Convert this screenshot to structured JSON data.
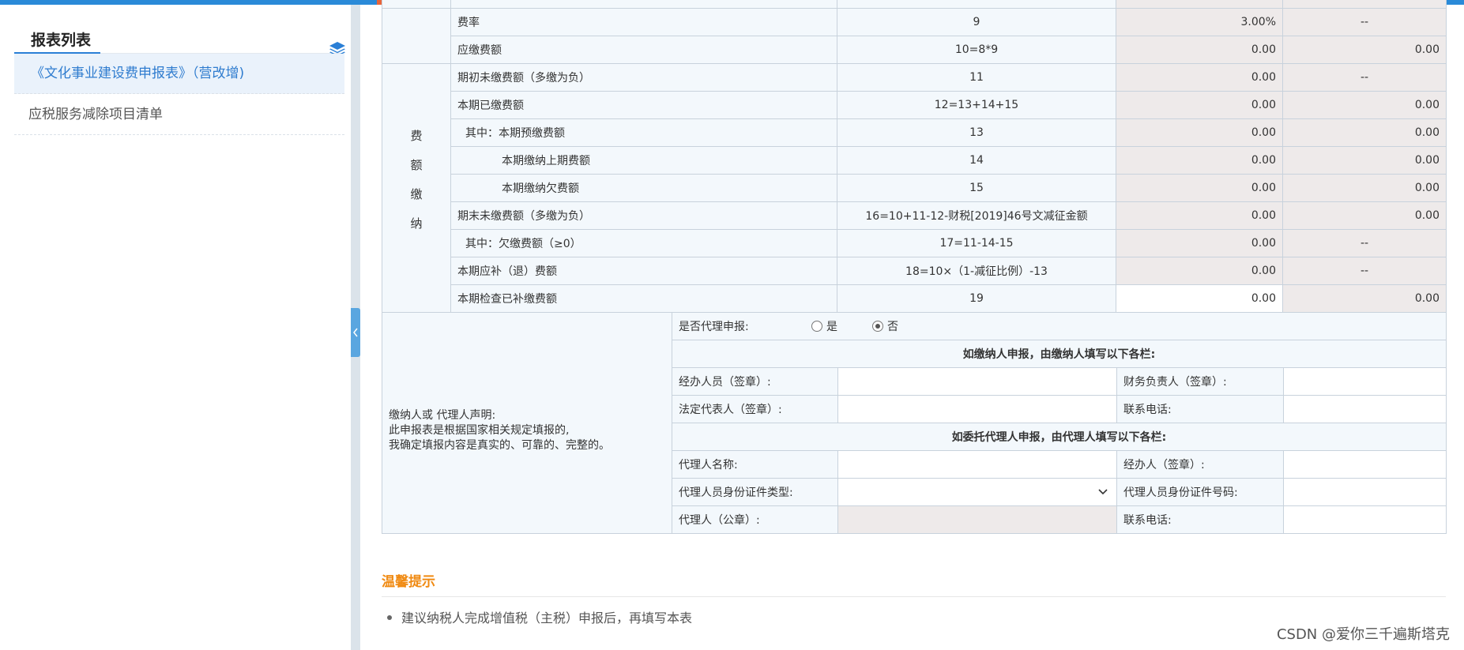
{
  "sidebar": {
    "title": "报表列表",
    "items": [
      {
        "label": "《文化事业建设费申报表》（营改增)"
      },
      {
        "label": "应税服务减除项目清单"
      }
    ]
  },
  "section_label": "费额缴纳",
  "rows": [
    {
      "name": "费率",
      "num": "9",
      "v1": "3.00%",
      "v2": "--",
      "indent": 0,
      "v1_style": "grey",
      "v2_style": "dash"
    },
    {
      "name": "应缴费额",
      "num": "10=8*9",
      "v1": "0.00",
      "v2": "0.00",
      "indent": 0,
      "v1_style": "grey",
      "v2_style": "grey"
    },
    {
      "name": "期初未缴费额（多缴为负）",
      "num": "11",
      "v1": "0.00",
      "v2": "--",
      "indent": 0,
      "v1_style": "grey",
      "v2_style": "dash"
    },
    {
      "name": "本期已缴费额",
      "num": "12=13+14+15",
      "v1": "0.00",
      "v2": "0.00",
      "indent": 0,
      "v1_style": "grey",
      "v2_style": "grey"
    },
    {
      "name": "其中：本期预缴费额",
      "num": "13",
      "v1": "0.00",
      "v2": "0.00",
      "indent": 1,
      "v1_style": "grey",
      "v2_style": "grey"
    },
    {
      "name": "本期缴纳上期费额",
      "num": "14",
      "v1": "0.00",
      "v2": "0.00",
      "indent": 2,
      "v1_style": "grey",
      "v2_style": "grey"
    },
    {
      "name": "本期缴纳欠费额",
      "num": "15",
      "v1": "0.00",
      "v2": "0.00",
      "indent": 2,
      "v1_style": "grey",
      "v2_style": "grey"
    },
    {
      "name": "期末未缴费额（多缴为负）",
      "num": "16=10+11-12-财税[2019]46号文减征金额",
      "v1": "0.00",
      "v2": "0.00",
      "indent": 0,
      "v1_style": "grey",
      "v2_style": "grey"
    },
    {
      "name": "其中：欠缴费额（≥0）",
      "num": "17=11-14-15",
      "v1": "0.00",
      "v2": "--",
      "indent": 1,
      "v1_style": "grey",
      "v2_style": "dash"
    },
    {
      "name": "本期应补（退）费额",
      "num": "18=10×（1-减征比例）-13",
      "v1": "0.00",
      "v2": "--",
      "indent": 0,
      "v1_style": "grey",
      "v2_style": "dash"
    },
    {
      "name": "本期检查已补缴费额",
      "num": "19",
      "v1": "0.00",
      "v2": "0.00",
      "indent": 0,
      "v1_style": "white",
      "v2_style": "grey"
    }
  ],
  "declaration": {
    "statement": "缴纳人或 代理人声明:\n此申报表是根据国家相关规定填报的,\n我确定填报内容是真实的、可靠的、完整的。",
    "agent_question": "是否代理申报:",
    "option_yes": "是",
    "option_no": "否",
    "selected": "否",
    "payer_heading": "如缴纳人申报，由缴纳人填写以下各栏:",
    "handler_label": "经办人员（签章）:",
    "finance_label": "财务负责人（签章）:",
    "legal_label": "法定代表人（签章）:",
    "phone_label": "联系电话:",
    "agent_heading": "如委托代理人申报，由代理人填写以下各栏:",
    "agent_name_label": "代理人名称:",
    "agent_handler_label": "经办人（签章）:",
    "id_type_label": "代理人员身份证件类型:",
    "id_number_label": "代理人员身份证件号码:",
    "agent_seal_label": "代理人（公章）:",
    "agent_phone_label": "联系电话:"
  },
  "tips": {
    "title": "温馨提示",
    "items": [
      "建议纳税人完成增值税（主税）申报后，再填写本表"
    ]
  },
  "watermark": "CSDN @爱你三千遍斯塔克",
  "colors": {
    "accent": "#2a7fd6",
    "tip": "#f08a12",
    "readonly": "#eeeaea",
    "label_bg": "#f3f8fc"
  }
}
